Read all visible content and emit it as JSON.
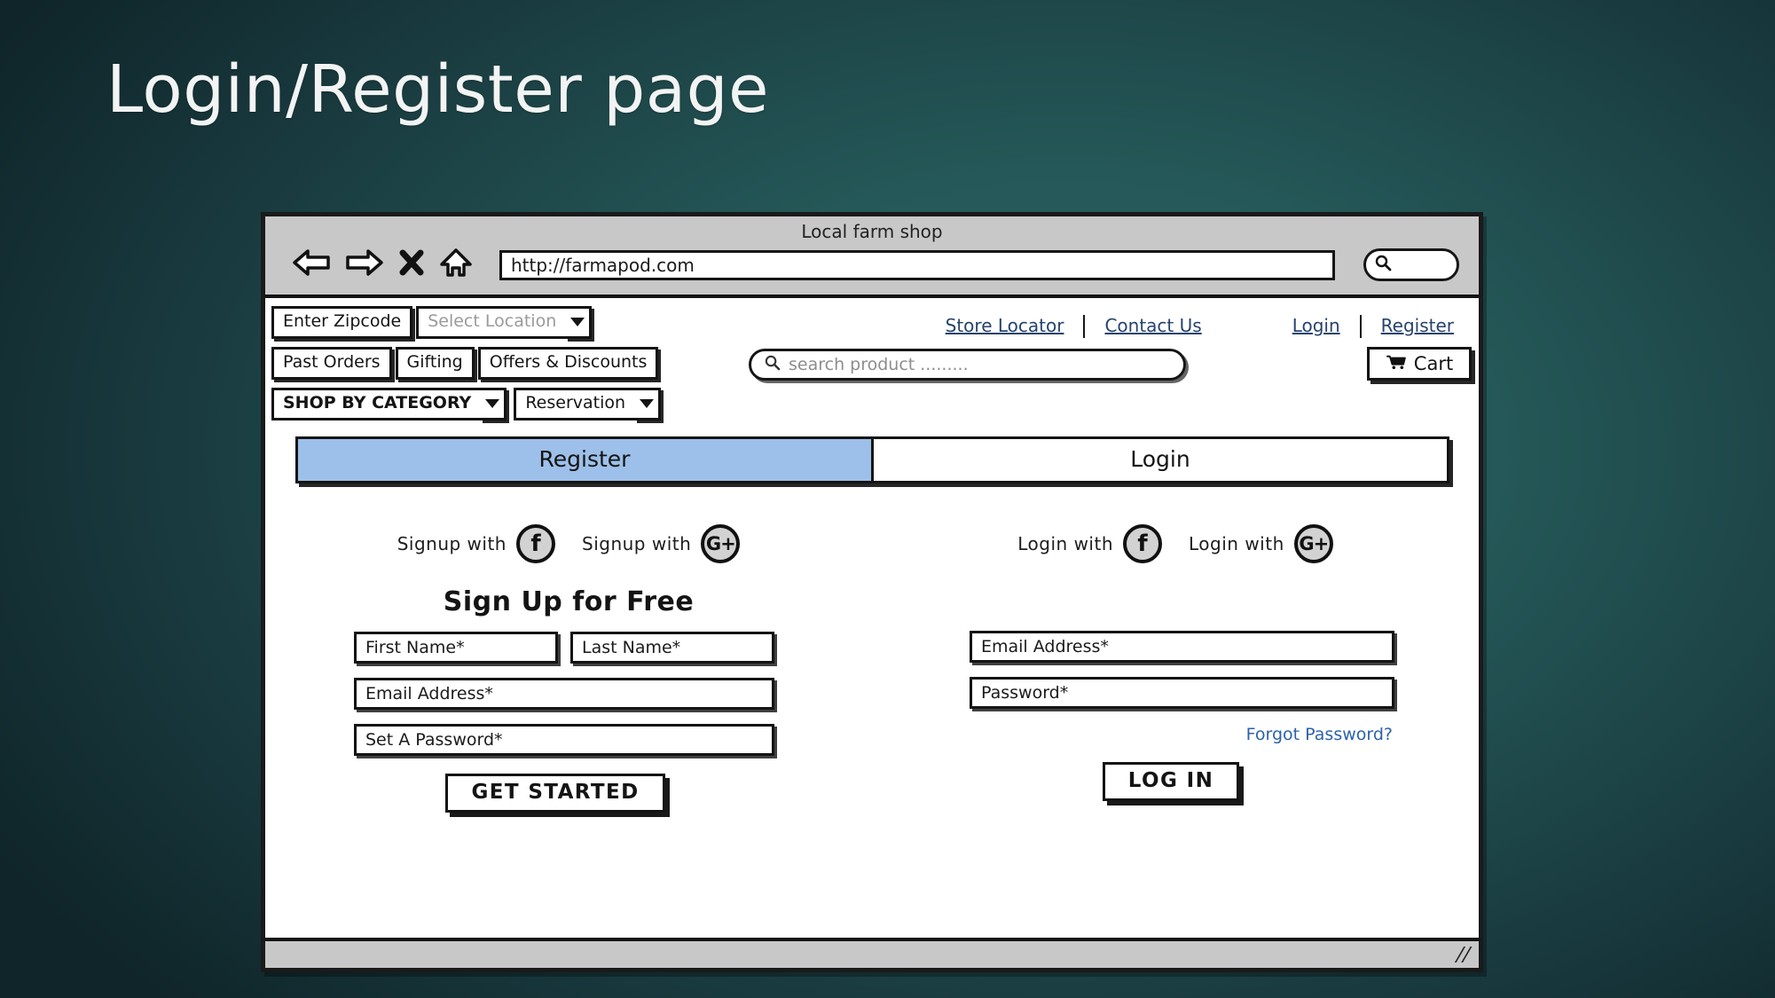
{
  "slide": {
    "title": "Login/Register page"
  },
  "browser": {
    "window_title": "Local farm shop",
    "url": "http://farmapod.com",
    "nav_icons": [
      "back-arrow-icon",
      "forward-arrow-icon",
      "stop-x-icon",
      "home-icon"
    ],
    "browser_search_icon": "magnifier-icon"
  },
  "site_header": {
    "zipcode_label": "Enter Zipcode",
    "location_label": "Select Location",
    "menu": [
      "Past Orders",
      "Gifting",
      "Offers & Discounts"
    ],
    "shop_by_category": "SHOP BY CATEGORY",
    "reservation": "Reservation",
    "links": [
      "Store Locator",
      "Contact Us",
      "Login",
      "Register"
    ],
    "search_placeholder": "search product .........",
    "cart_label": "Cart",
    "cart_icon": "shopping-cart-icon"
  },
  "tabs": [
    {
      "label": "Register",
      "active": true
    },
    {
      "label": "Login",
      "active": false
    }
  ],
  "register_panel": {
    "social": [
      {
        "label": "Signup  with",
        "provider": "facebook-icon",
        "glyph": "f"
      },
      {
        "label": "Signup  with",
        "provider": "google-plus-icon",
        "glyph": "G+"
      }
    ],
    "heading": "Sign Up for Free",
    "fields": {
      "first_name": "First Name*",
      "last_name": "Last Name*",
      "email": "Email Address*",
      "password": "Set A Password*"
    },
    "submit_label": "GET STARTED"
  },
  "login_panel": {
    "social": [
      {
        "label": "Login with",
        "provider": "facebook-icon",
        "glyph": "f"
      },
      {
        "label": "Login with",
        "provider": "google-plus-icon",
        "glyph": "G+"
      }
    ],
    "fields": {
      "email": "Email Address*",
      "password": "Password*"
    },
    "forgot_label": "Forgot Password?",
    "submit_label": "LOG IN"
  },
  "colors": {
    "slide_bg_dark": "#123035",
    "slide_bg_mid": "#2e6767",
    "active_tab": "#9cc0e9",
    "link_blue": "#27436e",
    "forgot_blue": "#2d62a8",
    "chrome_gray": "#c8c8c8",
    "ink": "#141414"
  },
  "status_bar": {
    "resize_grip_icon": "resize-grip-icon"
  }
}
